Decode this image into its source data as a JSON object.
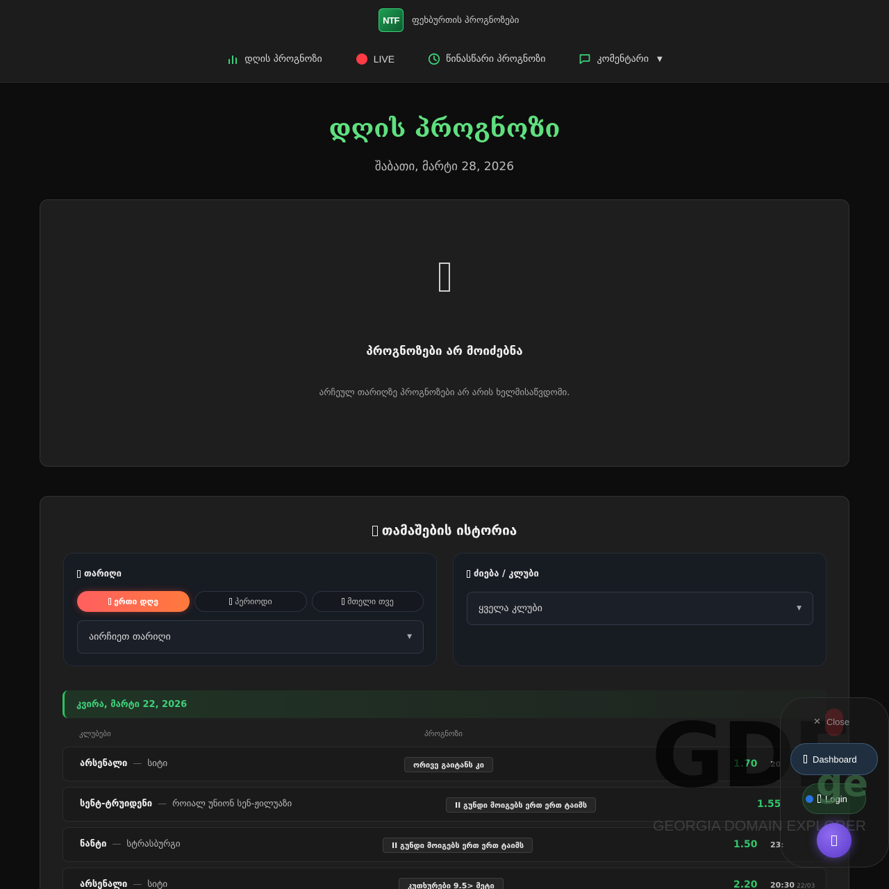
{
  "header": {
    "logo_text": "NTF",
    "brand": "ფეხბურთის პროგნოზები",
    "nav": [
      {
        "label": "დღის პროგნოზი",
        "icon": "bar-chart-icon",
        "color": "#3ed07a"
      },
      {
        "label": "LIVE",
        "icon": "live-dot-icon",
        "color": "#ff3b46"
      },
      {
        "label": "წინასწარი პროგნოზი",
        "icon": "clock-icon",
        "color": "#3ed07a"
      },
      {
        "label": "კომენტარი",
        "icon": "comment-icon",
        "color": "#3ed07a"
      }
    ],
    "dropdown_caret": "▼"
  },
  "page": {
    "title": "დღის პროგნოზი",
    "date": "შაბათი, მარტი 28, 2026"
  },
  "empty": {
    "icon": "placeholder-glyph-icon",
    "title": "პროგნოზები არ მოიძებნა",
    "subtitle": "არჩეულ თარიღზე პროგნოზები არ არის ხელმისაწვდომი."
  },
  "history": {
    "title": "თამაშების ისტორია",
    "date_filter": {
      "label": "თარიღი",
      "segments": [
        "ერთი დღე",
        "პერიოდი",
        "მთელი თვე"
      ],
      "active_segment": "ერთი დღე",
      "select_value": "აირჩიეთ თარიღი"
    },
    "club_filter": {
      "label": "ძიება / კლუბი",
      "select_value": "ყველა კლუბი"
    },
    "day_header": "კვირა, მარტი 22, 2026",
    "columns": {
      "clubs": "კლუბები",
      "prediction": "პროგნოზი"
    },
    "rows": [
      {
        "home": "არსენალი",
        "away": "სიტი",
        "tip": "ორივე გაიტანს კი",
        "odds": "1.70",
        "time": "20",
        "date": ""
      },
      {
        "home": "სენტ-ტრუიდენი",
        "away": "როიალ უნიონ სენ-ჟილუაზი",
        "tip": "II გუნდი მოიგებს ერთ ერთ ტაიმს",
        "odds": "1.55",
        "time": "",
        "date": ""
      },
      {
        "home": "ნანტი",
        "away": "სტრასბურგი",
        "tip": "II გუნდი მოიგებს ერთ ერთ ტაიმს",
        "odds": "1.50",
        "time": "23:",
        "date": ""
      },
      {
        "home": "არსენალი",
        "away": "სიტი",
        "tip": "კუთხურები 9.5> მეტი",
        "odds": "2.20",
        "time": "20:30",
        "date": "22/03"
      }
    ]
  },
  "overlay": {
    "close_label": "Close",
    "dashboard_label": "Dashboard",
    "login_label": "Login",
    "watermark_main": "GDE",
    "watermark_suffix": "ge",
    "watermark_sub": "GEORGIA DOMAIN EXPLORER"
  },
  "colors": {
    "accent_green": "#3ed07a",
    "title_green": "#5fe07f",
    "live_red": "#ff3b46",
    "active_segment": "#ff6a4a"
  }
}
